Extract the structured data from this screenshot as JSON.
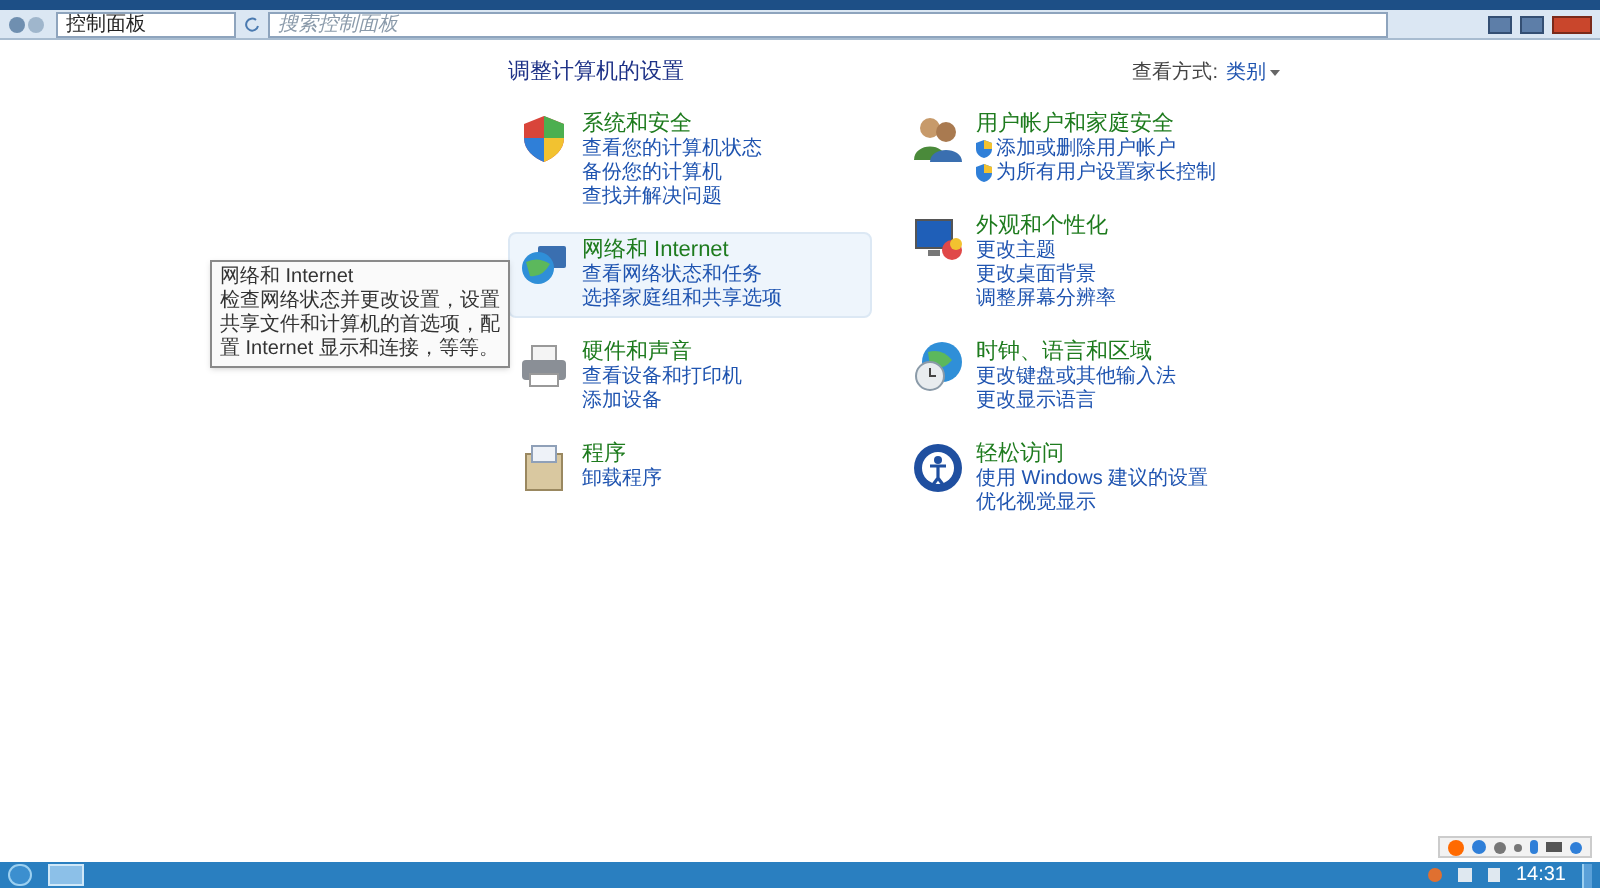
{
  "address_bar": {
    "path": "控制面板",
    "search_placeholder": "搜索控制面板"
  },
  "header": {
    "title": "调整计算机的设置",
    "view_label": "查看方式:",
    "view_value": "类别"
  },
  "left_categories": [
    {
      "title": "系统和安全",
      "hovered": false,
      "links": [
        {
          "text": "查看您的计算机状态",
          "shield": false
        },
        {
          "text": "备份您的计算机",
          "shield": false
        },
        {
          "text": "查找并解决问题",
          "shield": false
        }
      ]
    },
    {
      "title": "网络和 Internet",
      "hovered": true,
      "links": [
        {
          "text": "查看网络状态和任务",
          "shield": false
        },
        {
          "text": "选择家庭组和共享选项",
          "shield": false
        }
      ],
      "tooltip": {
        "title": "网络和 Internet",
        "body": "检查网络状态并更改设置，设置共享文件和计算机的首选项，配置 Internet 显示和连接，等等。"
      }
    },
    {
      "title": "硬件和声音",
      "hovered": false,
      "links": [
        {
          "text": "查看设备和打印机",
          "shield": false
        },
        {
          "text": "添加设备",
          "shield": false
        }
      ]
    },
    {
      "title": "程序",
      "hovered": false,
      "links": [
        {
          "text": "卸载程序",
          "shield": false
        }
      ]
    }
  ],
  "right_categories": [
    {
      "title": "用户帐户和家庭安全",
      "hovered": false,
      "links": [
        {
          "text": "添加或删除用户帐户",
          "shield": true
        },
        {
          "text": "为所有用户设置家长控制",
          "shield": true
        }
      ]
    },
    {
      "title": "外观和个性化",
      "hovered": false,
      "links": [
        {
          "text": "更改主题",
          "shield": false
        },
        {
          "text": "更改桌面背景",
          "shield": false
        },
        {
          "text": "调整屏幕分辨率",
          "shield": false
        }
      ]
    },
    {
      "title": "时钟、语言和区域",
      "hovered": false,
      "links": [
        {
          "text": "更改键盘或其他输入法",
          "shield": false
        },
        {
          "text": "更改显示语言",
          "shield": false
        }
      ]
    },
    {
      "title": "轻松访问",
      "hovered": false,
      "links": [
        {
          "text": "使用 Windows 建议的设置",
          "shield": false
        },
        {
          "text": "优化视觉显示",
          "shield": false
        }
      ]
    }
  ],
  "taskbar": {
    "clock": "14:31"
  }
}
